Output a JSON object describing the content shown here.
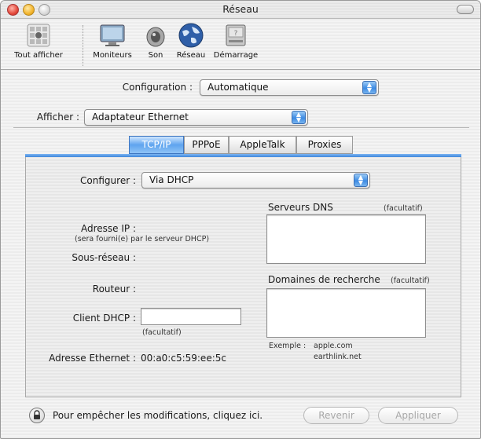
{
  "window": {
    "title": "Réseau"
  },
  "toolbar": {
    "items": [
      {
        "label": "Tout afficher",
        "icon": "apple-grid-icon"
      },
      {
        "label": "Moniteurs",
        "icon": "monitor-icon"
      },
      {
        "label": "Son",
        "icon": "speaker-icon"
      },
      {
        "label": "Réseau",
        "icon": "globe-icon"
      },
      {
        "label": "Démarrage",
        "icon": "disk-icon"
      }
    ]
  },
  "configuration": {
    "label": "Configuration :",
    "value": "Automatique"
  },
  "afficher": {
    "label": "Afficher :",
    "value": "Adaptateur Ethernet"
  },
  "tabs": [
    "TCP/IP",
    "PPPoE",
    "AppleTalk",
    "Proxies"
  ],
  "tcpip": {
    "configurer_label": "Configurer :",
    "configurer_value": "Via DHCP",
    "adresse_ip_label": "Adresse IP :",
    "adresse_ip_note": "(sera fourni(e) par le serveur DHCP)",
    "sous_reseau_label": "Sous-réseau :",
    "routeur_label": "Routeur :",
    "client_dhcp_label": "Client DHCP :",
    "client_dhcp_value": "",
    "facultatif": "(facultatif)",
    "adresse_ethernet_label": "Adresse Ethernet :",
    "adresse_ethernet_value": "00:a0:c5:59:ee:5c",
    "dns_label": "Serveurs DNS",
    "dns_optional": "(facultatif)",
    "domaines_label": "Domaines de recherche",
    "domaines_optional": "(facultatif)",
    "exemple_label": "Exemple :",
    "exemple_line1": "apple.com",
    "exemple_line2": "earthlink.net"
  },
  "footer": {
    "lock_text": "Pour empêcher les modifications, cliquez ici.",
    "revenir": "Revenir",
    "appliquer": "Appliquer"
  },
  "colors": {
    "accent": "#3d8be3",
    "tab_active": "#5ea4ef"
  }
}
